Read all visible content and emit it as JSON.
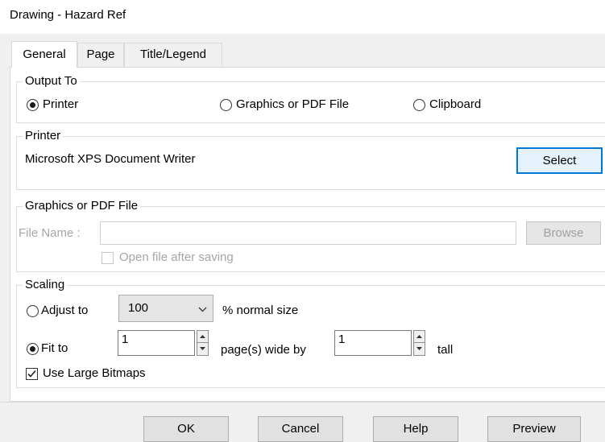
{
  "window": {
    "title": "Drawing - Hazard Ref"
  },
  "tabs": [
    {
      "label": "General",
      "active": true
    },
    {
      "label": "Page",
      "active": false
    },
    {
      "label": "Title/Legend",
      "active": false
    }
  ],
  "output_to": {
    "title": "Output To",
    "options": [
      {
        "label": "Printer",
        "checked": true
      },
      {
        "label": "Graphics or PDF File",
        "checked": false
      },
      {
        "label": "Clipboard",
        "checked": false
      }
    ]
  },
  "printer": {
    "title": "Printer",
    "name": "Microsoft XPS Document Writer",
    "select_label": "Select"
  },
  "graphics_file": {
    "title": "Graphics or PDF File",
    "file_name_label": "File Name :",
    "file_name_value": "",
    "browse_label": "Browse",
    "open_after_saving_label": "Open file after saving",
    "open_after_saving_checked": false
  },
  "scaling": {
    "title": "Scaling",
    "adjust_to_label": "Adjust to",
    "adjust_to_checked": false,
    "adjust_value": "100",
    "normal_size_label": "% normal size",
    "fit_to_label": "Fit to",
    "fit_to_checked": true,
    "pages_wide_value": "1",
    "pages_wide_label": "page(s) wide by",
    "pages_tall_value": "1",
    "tall_label": "tall",
    "large_bitmaps_label": "Use Large Bitmaps",
    "large_bitmaps_checked": true
  },
  "buttons": {
    "ok": "OK",
    "cancel": "Cancel",
    "help": "Help",
    "preview": "Preview"
  },
  "colors": {
    "focus_border": "#0078d7",
    "window_bg": "#f0f0f0",
    "page_bg": "#ffffff"
  }
}
